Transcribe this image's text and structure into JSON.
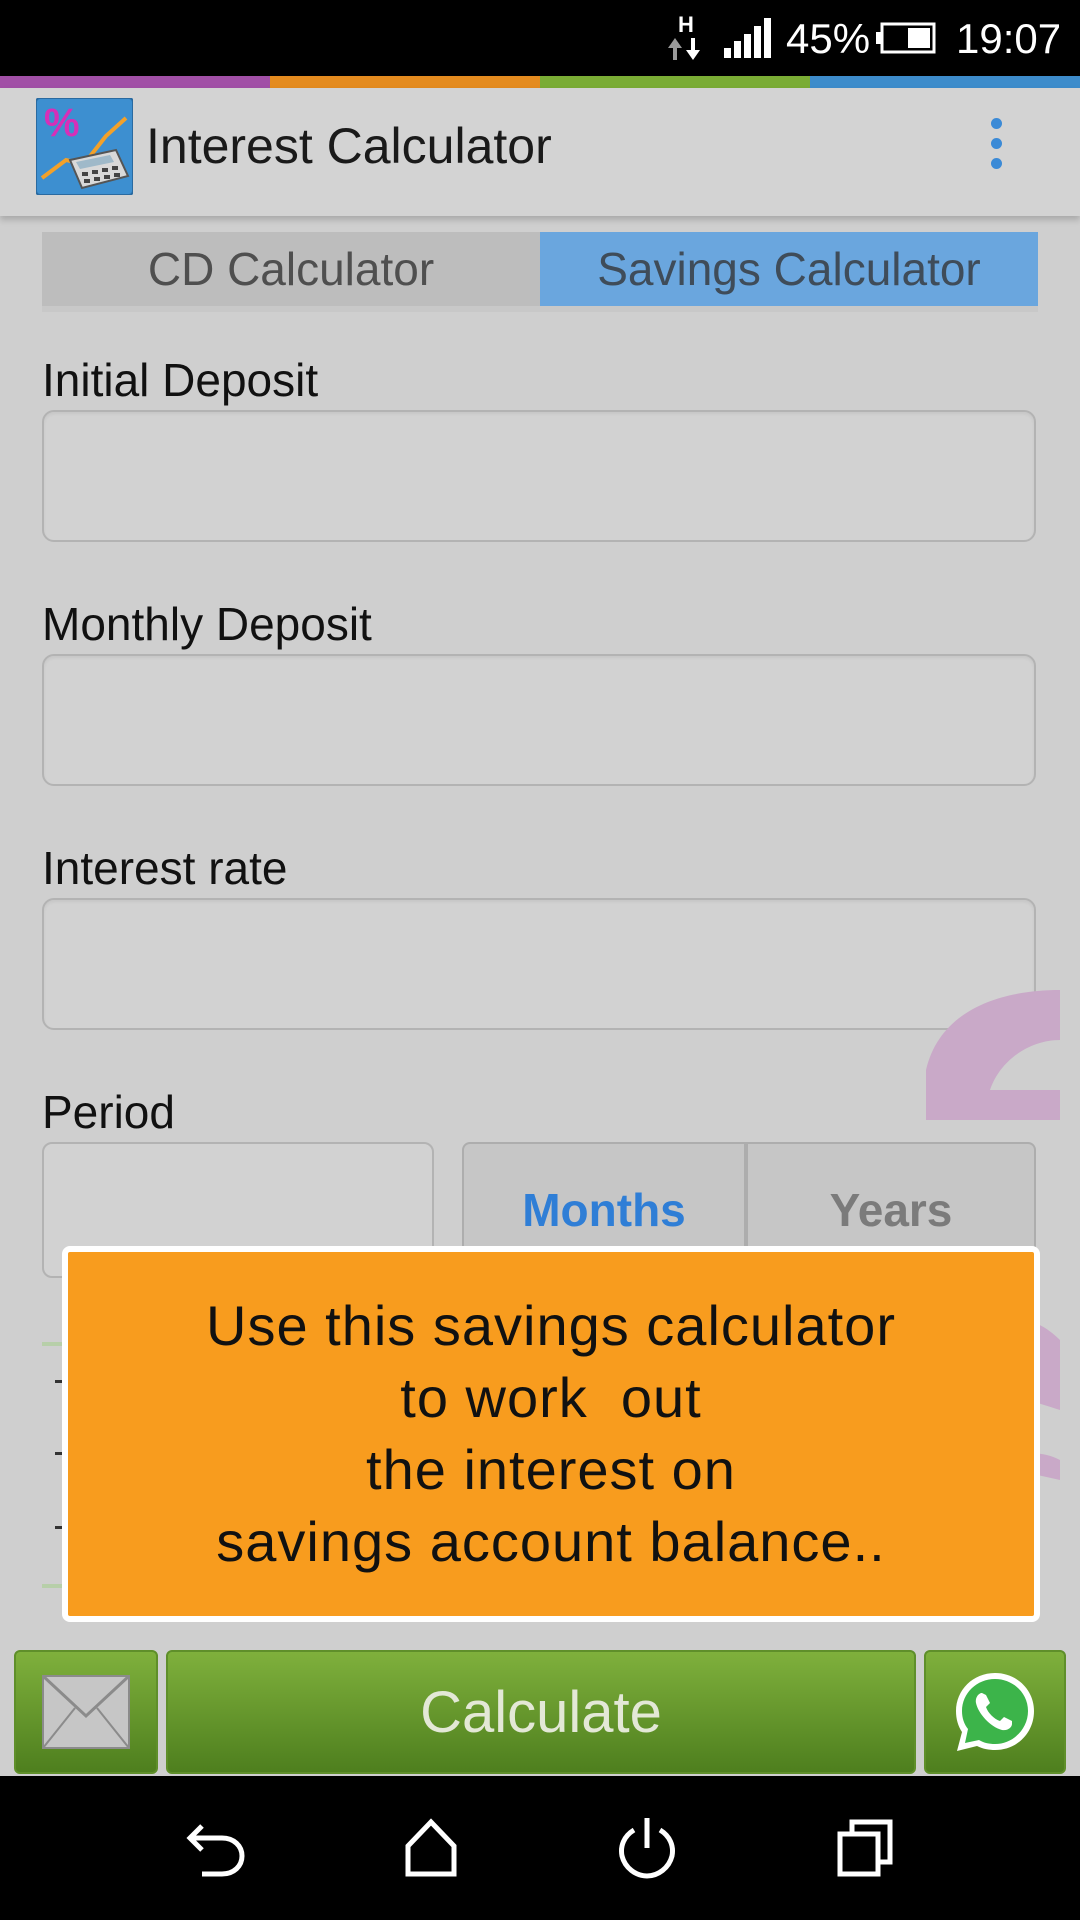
{
  "status_bar": {
    "network": "H",
    "battery_percent": "45%",
    "time": "19:07"
  },
  "stripe_colors": [
    "#a14fa6",
    "#e48b1f",
    "#7aac35",
    "#3d8ccb"
  ],
  "app_bar": {
    "title": "Interest Calculator",
    "menu_icon": "overflow-menu-icon"
  },
  "tabs": [
    {
      "label": "CD Calculator",
      "active": false
    },
    {
      "label": "Savings Calculator",
      "active": true
    }
  ],
  "form": {
    "initial_deposit_label": "Initial Deposit",
    "initial_deposit_value": "",
    "monthly_deposit_label": "Monthly Deposit",
    "monthly_deposit_value": "",
    "interest_rate_label": "Interest rate",
    "interest_rate_value": "",
    "period_label": "Period",
    "period_value": "",
    "period_units": [
      "Months",
      "Years"
    ],
    "period_unit_selected": "Months"
  },
  "toast": {
    "lines": [
      "Use this savings calculator",
      "to work  out",
      "the interest on",
      "savings account balance.."
    ]
  },
  "actions": {
    "calculate_label": "Calculate",
    "email_icon": "envelope-icon",
    "share_icon": "whatsapp-icon"
  },
  "colors": {
    "accent_blue": "#3b8ad6",
    "tab_active": "#6aa6de",
    "toast_bg": "#f89c1e",
    "button_green": "#6a9a2e"
  }
}
